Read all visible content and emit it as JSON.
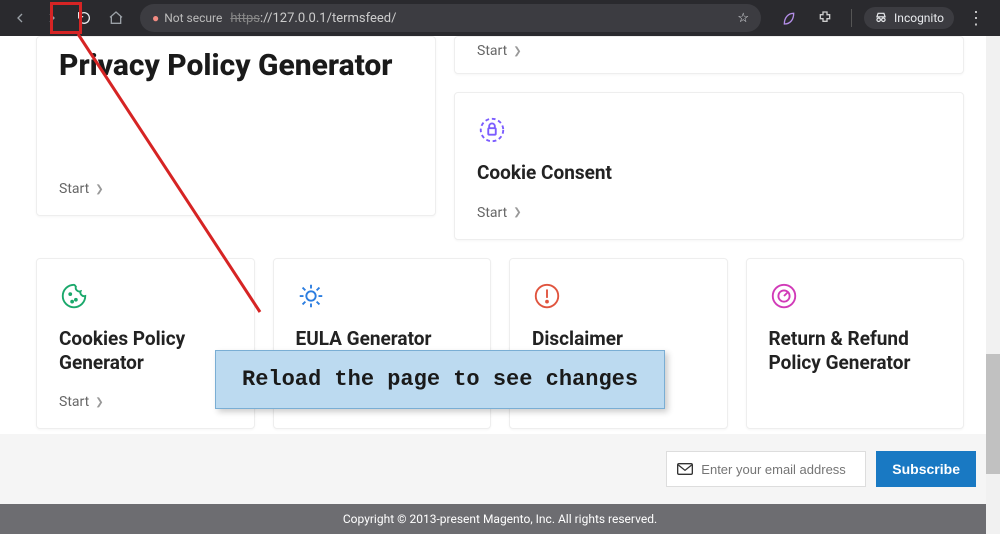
{
  "browser": {
    "not_secure_label": "Not secure",
    "url_strike": "https",
    "url_rest": "://127.0.0.1/termsfeed/",
    "incognito_label": "Incognito"
  },
  "cards": {
    "privacy": {
      "title": "Privacy Policy Generator",
      "start": "Start"
    },
    "top_right_start": "Start",
    "cookie_consent": {
      "title": "Cookie Consent",
      "start": "Start"
    },
    "cookies_policy": {
      "title": "Cookies Policy Generator",
      "start": "Start"
    },
    "eula": {
      "title": "EULA Generator"
    },
    "disclaimer": {
      "title": "Disclaimer Generator"
    },
    "return_refund": {
      "title": "Return & Refund Policy Generator"
    }
  },
  "tooltip": "Reload the page to see changes",
  "subscribe": {
    "placeholder": "Enter your email address",
    "button": "Subscribe"
  },
  "footer": "Copyright © 2013-present Magento, Inc. All rights reserved."
}
